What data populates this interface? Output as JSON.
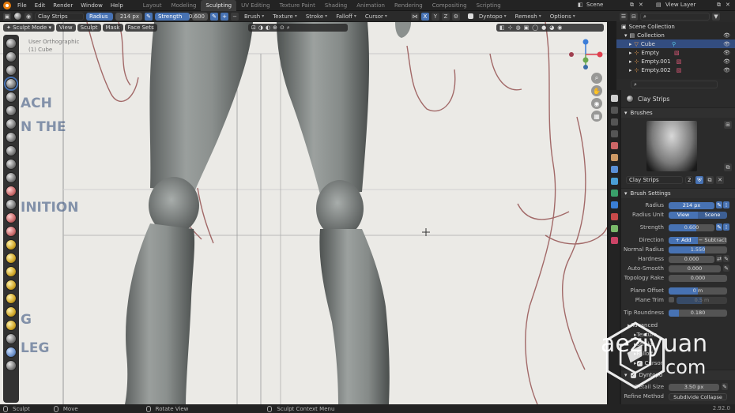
{
  "menubar": {
    "menus": [
      "File",
      "Edit",
      "Render",
      "Window",
      "Help"
    ],
    "workspaces": [
      "Layout",
      "Modeling",
      "Sculpting",
      "UV Editing",
      "Texture Paint",
      "Shading",
      "Animation",
      "Rendering",
      "Compositing",
      "Scripting"
    ],
    "active_workspace": "Sculpting",
    "scene": "Scene",
    "view_layer": "View Layer"
  },
  "toolhdr": {
    "brush_name": "Clay Strips",
    "radius_label": "Radius",
    "radius_value": "214 px",
    "strength_label": "Strength",
    "strength_value": "0.600",
    "plus": "+",
    "minus": "−",
    "menus": [
      "Brush",
      "Texture",
      "Stroke",
      "Falloff",
      "Cursor"
    ],
    "axes": [
      "X",
      "Y",
      "Z"
    ],
    "dyntopo": "Dyntopo",
    "remesh": "Remesh",
    "options": "Options"
  },
  "viewport": {
    "mode": "Sculpt Mode",
    "menus": [
      "View",
      "Sculpt",
      "Mask",
      "Face Sets"
    ],
    "overlay_line1": "User Orthographic",
    "overlay_line2": "(1) Cube",
    "sketch_words": [
      "ACH",
      "N THE",
      "INITION",
      "G",
      "LEG"
    ]
  },
  "outliner": {
    "title": "Scene Collection",
    "rows": [
      {
        "label": "Collection",
        "selected": false
      },
      {
        "label": "Cube",
        "selected": true
      },
      {
        "label": "Empty",
        "selected": false
      },
      {
        "label": "Empty.001",
        "selected": false
      },
      {
        "label": "Empty.002",
        "selected": false
      }
    ]
  },
  "properties": {
    "tool_title": "Clay Strips",
    "brushes_panel": "Brushes",
    "brush_name": "Clay Strips",
    "brush_users": "2",
    "brush_settings_panel": "Brush Settings",
    "radius": {
      "label": "Radius",
      "value": "214 px"
    },
    "radius_unit": {
      "label": "Radius Unit",
      "options": [
        "View",
        "Scene"
      ],
      "selected": "View"
    },
    "strength": {
      "label": "Strength",
      "value": "0.600",
      "fill": 0.6
    },
    "direction": {
      "label": "Direction",
      "options": [
        "+ Add",
        "− Subtract"
      ],
      "selected": "+ Add"
    },
    "normal_radius": {
      "label": "Normal Radius",
      "value": "1.550",
      "fill": 0.62
    },
    "hardness": {
      "label": "Hardness",
      "value": "0.000",
      "fill": 0
    },
    "auto_smooth": {
      "label": "Auto-Smooth",
      "value": "0.000",
      "fill": 0
    },
    "topology_rake": {
      "label": "Topology Rake",
      "value": "0.000",
      "fill": 0
    },
    "plane_offset": {
      "label": "Plane Offset",
      "value": "0 m",
      "fill": 0.5
    },
    "plane_trim": {
      "label": "Plane Trim",
      "value": "0.5 m",
      "fill": 0.5
    },
    "tip_roundness": {
      "label": "Tip Roundness",
      "value": "0.180",
      "fill": 0.18
    },
    "advanced": "Advanced",
    "texture": "Texture",
    "stroke": "Stroke",
    "falloff": "Falloff",
    "cursor": "Cursor",
    "dyntopo": "Dyntopo",
    "detail_size": {
      "label": "Detail Size",
      "value": "3.50 px"
    },
    "refine_method": {
      "label": "Refine Method",
      "value": "Subdivide Collapse"
    }
  },
  "status": {
    "items": [
      "Sculpt",
      "Move",
      "Rotate View",
      "Sculpt Context Menu"
    ],
    "version": "2.92.0"
  },
  "watermark": {
    "line1": "aeziyuan",
    "line2": "com"
  },
  "colors": {
    "accent": "#4772b3",
    "selection": "#334d80",
    "viewport_bg": "#e9e8e4",
    "ui_bg": "#2b2b2b"
  }
}
